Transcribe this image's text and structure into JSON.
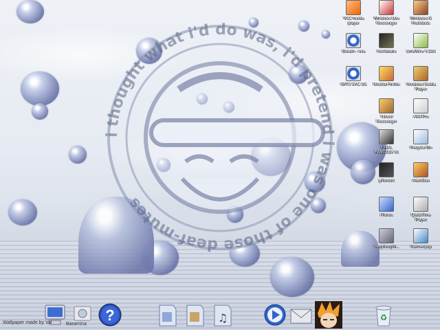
{
  "wallpaper": {
    "logo_text": "i thought what i'd do was, i'd pretend i was one of those deaf-mutes",
    "credit": "Wallpaper made by Val"
  },
  "desktop_icons": [
    {
      "label": "VLC media player",
      "icon": "vlc-icon"
    },
    {
      "label": "Windows Live Messenger",
      "icon": "messenger-icon"
    },
    {
      "label": "Windows-G Rockdock",
      "icon": "rocketdock-icon"
    },
    {
      "label": "Bleach - ova",
      "icon": "video-file-icon"
    },
    {
      "label": "KoAdware",
      "icon": "anime-icon"
    },
    {
      "label": "LimeWire 4.13.8",
      "icon": "limewire-icon"
    },
    {
      "label": "GITS SAC 2G",
      "icon": "video-file-icon"
    },
    {
      "label": "Mozilla Firefox",
      "icon": "firefox-icon"
    },
    {
      "label": "Windows Media Player",
      "icon": "media-player-icon"
    },
    {
      "label": "Yahoo! Messenger",
      "icon": "yahoo-icon"
    },
    {
      "label": "AIM Pro",
      "icon": "aim-icon"
    },
    {
      "label": "FINAL FANTASY XI",
      "icon": "ffxi-icon"
    },
    {
      "label": "Recycle Bin",
      "icon": "recycle-bin-icon"
    },
    {
      "label": "µTorrent",
      "icon": "utorrent-icon"
    },
    {
      "label": "AlienSkin",
      "icon": "alien-icon"
    },
    {
      "label": "iTunes",
      "icon": "itunes-icon"
    },
    {
      "label": "QuickTime Player",
      "icon": "quicktime-icon"
    },
    {
      "label": "VeryBerryBl...",
      "icon": "anime-icon"
    },
    {
      "label": "Banner.psp",
      "icon": "image-file-icon"
    }
  ],
  "dock": {
    "items": [
      {
        "name": "my-computer-icon",
        "label": "Baramina"
      },
      {
        "name": "network-icon",
        "label": ""
      },
      {
        "name": "help-icon",
        "label": ""
      },
      {
        "name": "documents-folder-icon",
        "label": ""
      },
      {
        "name": "pictures-folder-icon",
        "label": ""
      },
      {
        "name": "music-folder-icon",
        "label": ""
      },
      {
        "name": "media-player-icon",
        "label": ""
      },
      {
        "name": "mail-icon",
        "label": ""
      },
      {
        "name": "character-icon",
        "label": ""
      },
      {
        "name": "recycle-bin-icon",
        "label": ""
      }
    ]
  }
}
